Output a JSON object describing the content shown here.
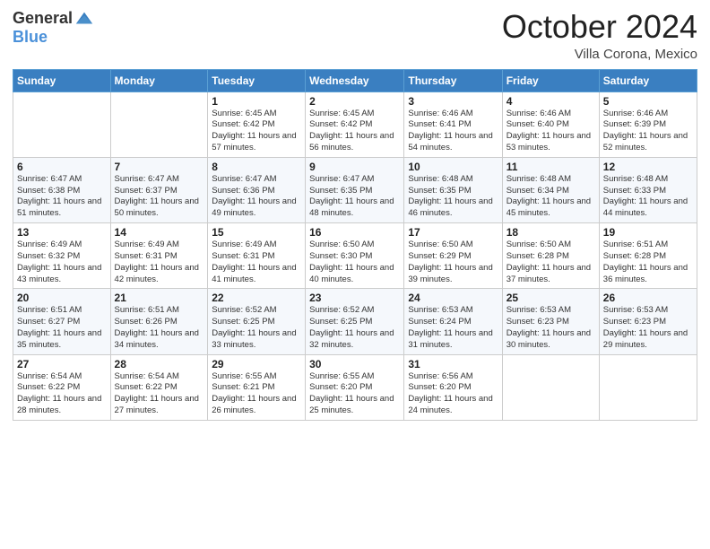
{
  "header": {
    "logo_general": "General",
    "logo_blue": "Blue",
    "month_title": "October 2024",
    "subtitle": "Villa Corona, Mexico"
  },
  "weekdays": [
    "Sunday",
    "Monday",
    "Tuesday",
    "Wednesday",
    "Thursday",
    "Friday",
    "Saturday"
  ],
  "weeks": [
    [
      {
        "day": "",
        "info": ""
      },
      {
        "day": "",
        "info": ""
      },
      {
        "day": "1",
        "info": "Sunrise: 6:45 AM\nSunset: 6:42 PM\nDaylight: 11 hours and 57 minutes."
      },
      {
        "day": "2",
        "info": "Sunrise: 6:45 AM\nSunset: 6:42 PM\nDaylight: 11 hours and 56 minutes."
      },
      {
        "day": "3",
        "info": "Sunrise: 6:46 AM\nSunset: 6:41 PM\nDaylight: 11 hours and 54 minutes."
      },
      {
        "day": "4",
        "info": "Sunrise: 6:46 AM\nSunset: 6:40 PM\nDaylight: 11 hours and 53 minutes."
      },
      {
        "day": "5",
        "info": "Sunrise: 6:46 AM\nSunset: 6:39 PM\nDaylight: 11 hours and 52 minutes."
      }
    ],
    [
      {
        "day": "6",
        "info": "Sunrise: 6:47 AM\nSunset: 6:38 PM\nDaylight: 11 hours and 51 minutes."
      },
      {
        "day": "7",
        "info": "Sunrise: 6:47 AM\nSunset: 6:37 PM\nDaylight: 11 hours and 50 minutes."
      },
      {
        "day": "8",
        "info": "Sunrise: 6:47 AM\nSunset: 6:36 PM\nDaylight: 11 hours and 49 minutes."
      },
      {
        "day": "9",
        "info": "Sunrise: 6:47 AM\nSunset: 6:35 PM\nDaylight: 11 hours and 48 minutes."
      },
      {
        "day": "10",
        "info": "Sunrise: 6:48 AM\nSunset: 6:35 PM\nDaylight: 11 hours and 46 minutes."
      },
      {
        "day": "11",
        "info": "Sunrise: 6:48 AM\nSunset: 6:34 PM\nDaylight: 11 hours and 45 minutes."
      },
      {
        "day": "12",
        "info": "Sunrise: 6:48 AM\nSunset: 6:33 PM\nDaylight: 11 hours and 44 minutes."
      }
    ],
    [
      {
        "day": "13",
        "info": "Sunrise: 6:49 AM\nSunset: 6:32 PM\nDaylight: 11 hours and 43 minutes."
      },
      {
        "day": "14",
        "info": "Sunrise: 6:49 AM\nSunset: 6:31 PM\nDaylight: 11 hours and 42 minutes."
      },
      {
        "day": "15",
        "info": "Sunrise: 6:49 AM\nSunset: 6:31 PM\nDaylight: 11 hours and 41 minutes."
      },
      {
        "day": "16",
        "info": "Sunrise: 6:50 AM\nSunset: 6:30 PM\nDaylight: 11 hours and 40 minutes."
      },
      {
        "day": "17",
        "info": "Sunrise: 6:50 AM\nSunset: 6:29 PM\nDaylight: 11 hours and 39 minutes."
      },
      {
        "day": "18",
        "info": "Sunrise: 6:50 AM\nSunset: 6:28 PM\nDaylight: 11 hours and 37 minutes."
      },
      {
        "day": "19",
        "info": "Sunrise: 6:51 AM\nSunset: 6:28 PM\nDaylight: 11 hours and 36 minutes."
      }
    ],
    [
      {
        "day": "20",
        "info": "Sunrise: 6:51 AM\nSunset: 6:27 PM\nDaylight: 11 hours and 35 minutes."
      },
      {
        "day": "21",
        "info": "Sunrise: 6:51 AM\nSunset: 6:26 PM\nDaylight: 11 hours and 34 minutes."
      },
      {
        "day": "22",
        "info": "Sunrise: 6:52 AM\nSunset: 6:25 PM\nDaylight: 11 hours and 33 minutes."
      },
      {
        "day": "23",
        "info": "Sunrise: 6:52 AM\nSunset: 6:25 PM\nDaylight: 11 hours and 32 minutes."
      },
      {
        "day": "24",
        "info": "Sunrise: 6:53 AM\nSunset: 6:24 PM\nDaylight: 11 hours and 31 minutes."
      },
      {
        "day": "25",
        "info": "Sunrise: 6:53 AM\nSunset: 6:23 PM\nDaylight: 11 hours and 30 minutes."
      },
      {
        "day": "26",
        "info": "Sunrise: 6:53 AM\nSunset: 6:23 PM\nDaylight: 11 hours and 29 minutes."
      }
    ],
    [
      {
        "day": "27",
        "info": "Sunrise: 6:54 AM\nSunset: 6:22 PM\nDaylight: 11 hours and 28 minutes."
      },
      {
        "day": "28",
        "info": "Sunrise: 6:54 AM\nSunset: 6:22 PM\nDaylight: 11 hours and 27 minutes."
      },
      {
        "day": "29",
        "info": "Sunrise: 6:55 AM\nSunset: 6:21 PM\nDaylight: 11 hours and 26 minutes."
      },
      {
        "day": "30",
        "info": "Sunrise: 6:55 AM\nSunset: 6:20 PM\nDaylight: 11 hours and 25 minutes."
      },
      {
        "day": "31",
        "info": "Sunrise: 6:56 AM\nSunset: 6:20 PM\nDaylight: 11 hours and 24 minutes."
      },
      {
        "day": "",
        "info": ""
      },
      {
        "day": "",
        "info": ""
      }
    ]
  ]
}
